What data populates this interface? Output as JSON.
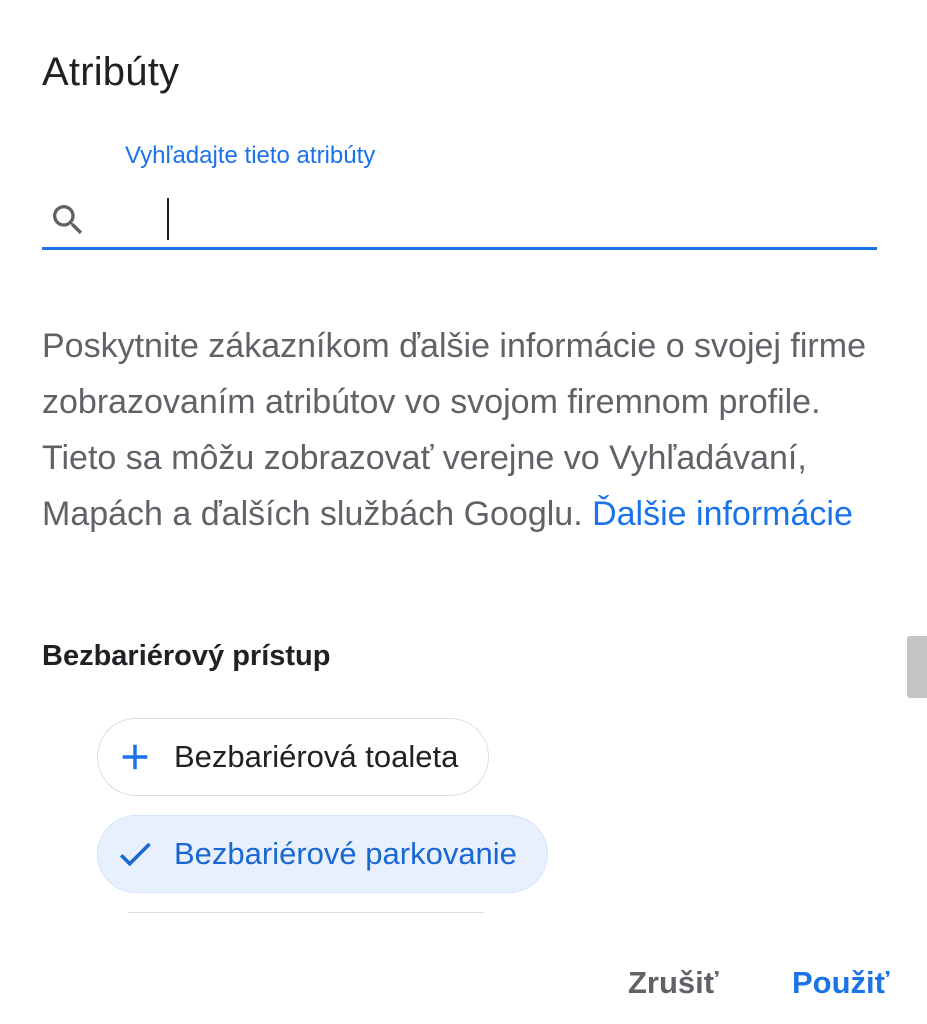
{
  "dialog": {
    "title": "Atribúty"
  },
  "search": {
    "label": "Vyhľadajte tieto atribúty",
    "value": "",
    "placeholder": ""
  },
  "description": {
    "text": "Poskytnite zákazníkom ďalšie informácie o svojej firme zobrazovaním atribútov vo svojom firemnom profile. Tieto sa môžu zobrazovať verejne vo Vyhľadávaní, Mapách a ďalších službách Googlu. ",
    "link_label": "Ďalšie informácie"
  },
  "section": {
    "title": "Bezbariérový prístup",
    "chips": [
      {
        "label": "Bezbariérová toaleta",
        "selected": false,
        "icon": "plus-icon"
      },
      {
        "label": "Bezbariérové parkovanie",
        "selected": true,
        "icon": "check-icon"
      }
    ]
  },
  "actions": {
    "cancel_label": "Zrušiť",
    "apply_label": "Použiť"
  },
  "colors": {
    "accent": "#1a73e8",
    "selected_chip_bg": "#e8f0fe",
    "muted_text": "#5f6368"
  }
}
